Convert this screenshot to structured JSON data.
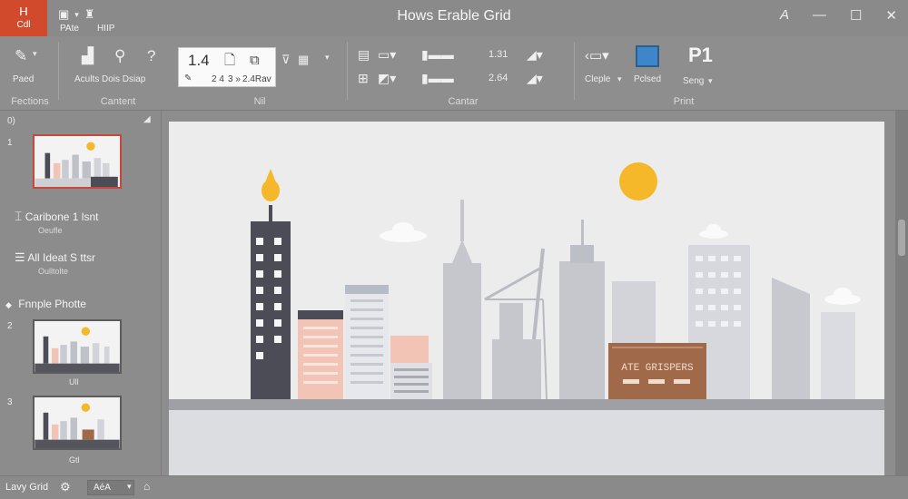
{
  "app": {
    "badge_top": "H",
    "badge_bottom": "Cdl"
  },
  "window": {
    "title": "Hows Erable Grid"
  },
  "menu": {
    "tabs": [
      "PAte",
      "HIIP"
    ]
  },
  "ribbon": {
    "groups": {
      "fections": {
        "label": "Fections",
        "item_label": "Paed"
      },
      "content": {
        "label": "Cantent",
        "item_label": "Acults Dois Dsiap"
      },
      "nil": {
        "label": "Nil",
        "value": "1.4",
        "sub1": "2 4",
        "sub2": "3 »",
        "sub3": "2.4Rav"
      },
      "cantar": {
        "label": "Cantar",
        "value1": "1.31",
        "value2": "2.64"
      },
      "print": {
        "label": "Print",
        "item1": "Cleple",
        "item2": "Pclsed",
        "big": "P1",
        "item3": "Seng"
      }
    }
  },
  "pane": {
    "top_label": "0)",
    "slides": [
      {
        "num": "1"
      },
      {
        "num": "2",
        "caption": "Ull"
      },
      {
        "num": "3",
        "caption": "Gtl"
      }
    ],
    "outline": [
      {
        "title": "Caribone 1 lsnt",
        "sub": "Oeufle"
      },
      {
        "title": "All Ideat S ttsr",
        "sub": "Oulltolte"
      },
      {
        "title": "Fnnple Photte",
        "sub": ""
      }
    ]
  },
  "slide": {
    "sign_text": "ATE GRISPERS"
  },
  "status": {
    "label": "Lavy Grid",
    "zoom": "AéA"
  },
  "colors": {
    "accent": "#d14a2c",
    "sun": "#f4b82a",
    "dark_tower": "#4b4c55",
    "salmon": "#f2c4b6",
    "brown_sign": "#a0694a",
    "ground": "#9ea0a6"
  }
}
